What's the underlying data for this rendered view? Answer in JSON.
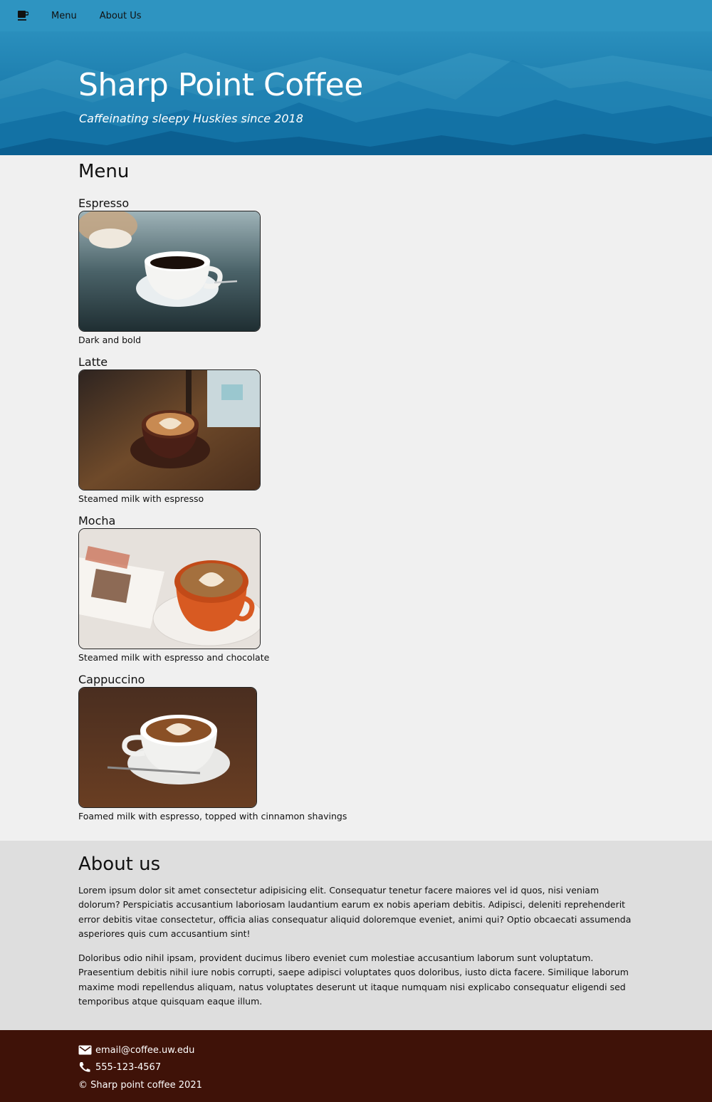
{
  "nav": {
    "logo_icon": "coffee-cup-icon",
    "links": [
      {
        "label": "Menu"
      },
      {
        "label": "About Us"
      }
    ]
  },
  "hero": {
    "title": "Sharp Point Coffee",
    "tagline": "Caffeinating sleepy Huskies since 2018"
  },
  "menu": {
    "title": "Menu",
    "items": [
      {
        "name": "Espresso",
        "description": "Dark and bold",
        "image": "espresso-photo"
      },
      {
        "name": "Latte",
        "description": "Steamed milk with espresso",
        "image": "latte-photo"
      },
      {
        "name": "Mocha",
        "description": "Steamed milk with espresso and chocolate",
        "image": "mocha-photo"
      },
      {
        "name": "Cappuccino",
        "description": "Foamed milk with espresso, topped with cinnamon shavings",
        "image": "cappuccino-photo"
      }
    ]
  },
  "about": {
    "title": "About us",
    "paragraphs": [
      "Lorem ipsum dolor sit amet consectetur adipisicing elit. Consequatur tenetur facere maiores vel id quos, nisi veniam dolorum? Perspiciatis accusantium laboriosam laudantium earum ex nobis aperiam debitis. Adipisci, deleniti reprehenderit error debitis vitae consectetur, officia alias consequatur aliquid doloremque eveniet, animi qui? Optio obcaecati assumenda asperiores quis cum accusantium sint!",
      "Doloribus odio nihil ipsam, provident ducimus libero eveniet cum molestiae accusantium laborum sunt voluptatum. Praesentium debitis nihil iure nobis corrupti, saepe adipisci voluptates quos doloribus, iusto dicta facere. Similique laborum maxime modi repellendus aliquam, natus voluptates deserunt ut itaque numquam nisi explicabo consequatur eligendi sed temporibus atque quisquam eaque illum."
    ]
  },
  "footer": {
    "email": "email@coffee.uw.edu",
    "phone": "555-123-4567",
    "copyright": "© Sharp point coffee 2021",
    "email_icon": "mail-icon",
    "phone_icon": "phone-icon"
  },
  "colors": {
    "nav_bg": "#2e94c1",
    "hero_bg": "#1a7aab",
    "page_bg": "#f0f0f0",
    "about_bg": "#dedede",
    "footer_bg": "#3f1208"
  }
}
